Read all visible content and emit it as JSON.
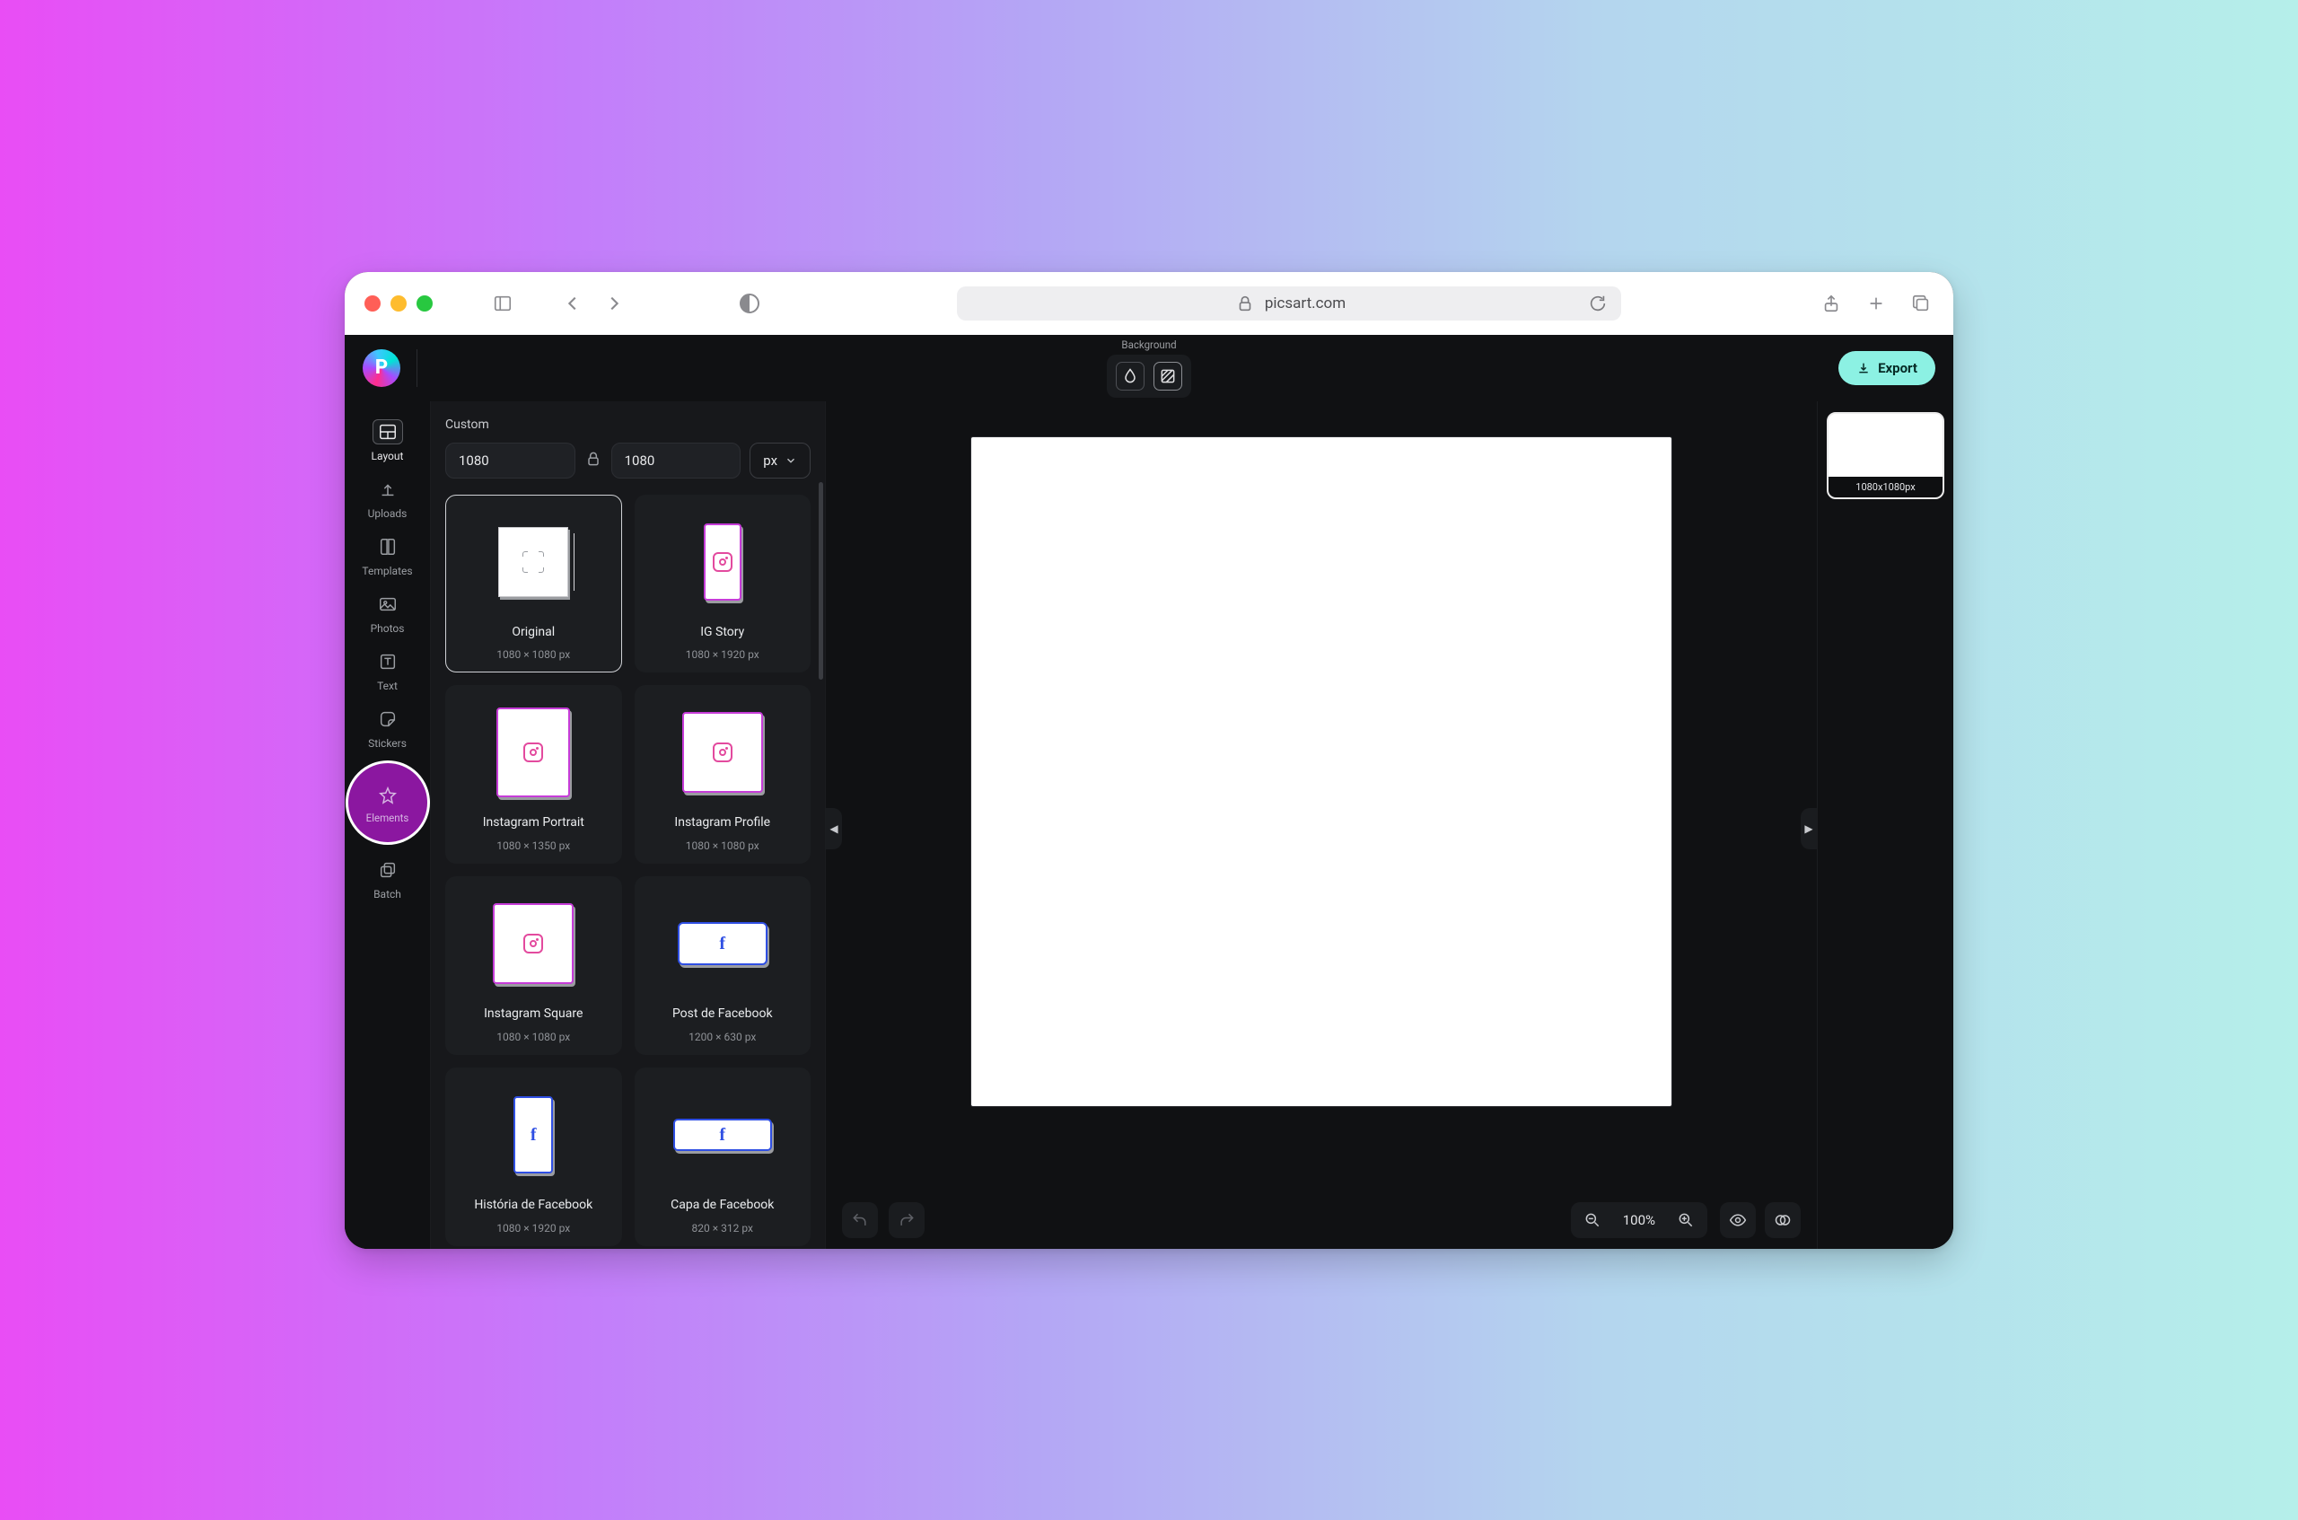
{
  "browser": {
    "url_host": "picsart.com"
  },
  "header": {
    "background_label": "Background",
    "export_label": "Export"
  },
  "rail": {
    "items": [
      {
        "id": "layout",
        "label": "Layout"
      },
      {
        "id": "uploads",
        "label": "Uploads"
      },
      {
        "id": "templates",
        "label": "Templates"
      },
      {
        "id": "photos",
        "label": "Photos"
      },
      {
        "id": "text",
        "label": "Text"
      },
      {
        "id": "stickers",
        "label": "Stickers"
      },
      {
        "id": "elements",
        "label": "Elements"
      },
      {
        "id": "batch",
        "label": "Batch"
      }
    ],
    "active": "layout",
    "highlight": "elements"
  },
  "panel": {
    "title": "Custom",
    "width": "1080",
    "height": "1080",
    "unit": "px",
    "presets": [
      {
        "id": "original",
        "name": "Original",
        "dims": "1080 × 1080 px",
        "thumb": "original",
        "selected": true
      },
      {
        "id": "ig-story",
        "name": "IG Story",
        "dims": "1080 × 1920 px",
        "thumb": "igstory"
      },
      {
        "id": "ig-portrait",
        "name": "Instagram Portrait",
        "dims": "1080 × 1350 px",
        "thumb": "igport"
      },
      {
        "id": "ig-profile",
        "name": "Instagram Profile",
        "dims": "1080 × 1080 px",
        "thumb": "igprof"
      },
      {
        "id": "ig-square",
        "name": "Instagram Square",
        "dims": "1080 × 1080 px",
        "thumb": "igsq"
      },
      {
        "id": "fb-post",
        "name": "Post de Facebook",
        "dims": "1200 × 630 px",
        "thumb": "fbpost"
      },
      {
        "id": "fb-story",
        "name": "História de Facebook",
        "dims": "1080 × 1920 px",
        "thumb": "fbstory"
      },
      {
        "id": "fb-cover",
        "name": "Capa de Facebook",
        "dims": "820 × 312 px",
        "thumb": "fbcover"
      }
    ]
  },
  "pages": {
    "items": [
      {
        "caption": "1080x1080px"
      }
    ]
  },
  "bottombar": {
    "zoom_label": "100%"
  }
}
